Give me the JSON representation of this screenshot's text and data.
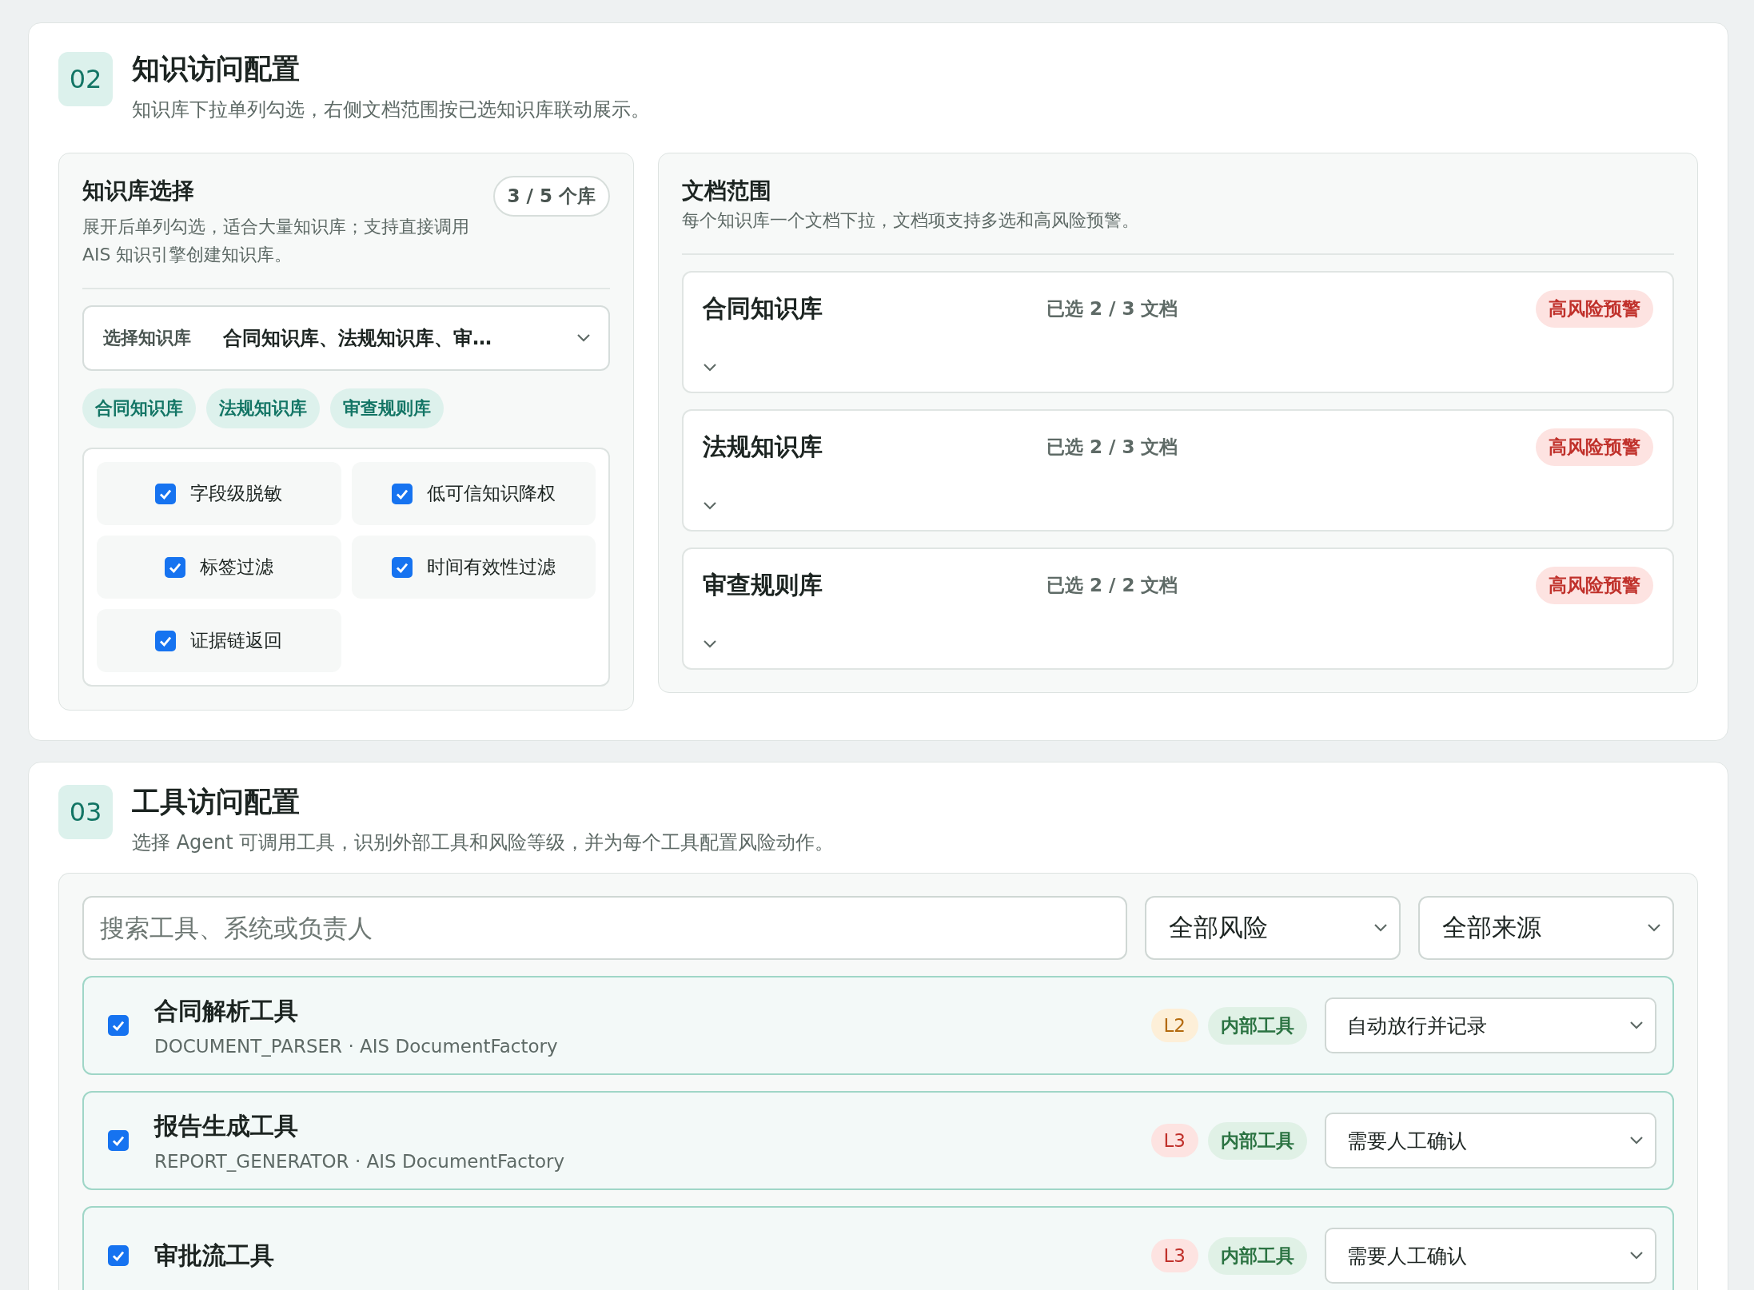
{
  "knowledge_section": {
    "number": "02",
    "title": "知识访问配置",
    "subtitle": "知识库下拉单列勾选，右侧文档范围按已选知识库联动展示。",
    "library_panel": {
      "title": "知识库选择",
      "count": "3 / 5 个库",
      "description": "展开后单列勾选，适合大量知识库；支持直接调用 AIS 知识引擎创建知识库。",
      "dropdown": {
        "label": "选择知识库",
        "value": "合同知识库、法规知识库、审…",
        "expanded": false
      },
      "tags": [
        "合同知识库",
        "法规知识库",
        "审查规则库"
      ],
      "options": [
        {
          "label": "字段级脱敏",
          "checked": true
        },
        {
          "label": "低可信知识降权",
          "checked": true
        },
        {
          "label": "标签过滤",
          "checked": true
        },
        {
          "label": "时间有效性过滤",
          "checked": true
        },
        {
          "label": "证据链返回",
          "checked": true
        }
      ]
    },
    "document_panel": {
      "title": "文档范围",
      "description": "每个知识库一个文档下拉，文档项支持多选和高风险预警。",
      "libraries": [
        {
          "name": "合同知识库",
          "selected_count": "已选 2 / 3 文档",
          "warning": "高风险预警",
          "expanded": false
        },
        {
          "name": "法规知识库",
          "selected_count": "已选 2 / 3 文档",
          "warning": "高风险预警",
          "expanded": false
        },
        {
          "name": "审查规则库",
          "selected_count": "已选 2 / 2 文档",
          "warning": "高风险预警",
          "expanded": false
        }
      ]
    }
  },
  "tool_section": {
    "number": "03",
    "title": "工具访问配置",
    "subtitle": "选择 Agent 可调用工具，识别外部工具和风险等级，并为每个工具配置风险动作。",
    "search": {
      "placeholder": "搜索工具、系统或负责人"
    },
    "filters": [
      "全部风险",
      "全部来源"
    ],
    "tools": [
      {
        "name": "合同解析工具",
        "detail": "DOCUMENT_PARSER · AIS DocumentFactory",
        "checked": true,
        "risk": {
          "label": "L2",
          "kind": "medium"
        },
        "source": "内部工具",
        "action": "自动放行并记录"
      },
      {
        "name": "报告生成工具",
        "detail": "REPORT_GENERATOR · AIS DocumentFactory",
        "checked": true,
        "risk": {
          "label": "L3",
          "kind": "high"
        },
        "source": "内部工具",
        "action": "需要人工确认"
      },
      {
        "name": "审批流工具",
        "checked": true,
        "risk": {
          "label": "L3",
          "kind": "high"
        },
        "source": "内部工具",
        "action": "需要人工确认"
      }
    ]
  }
}
